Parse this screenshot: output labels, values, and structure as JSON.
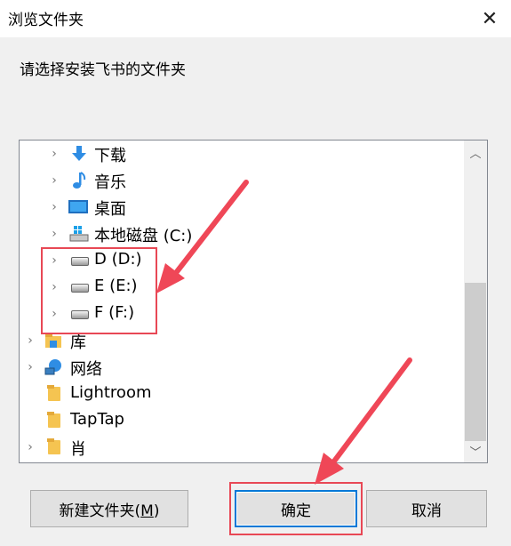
{
  "window": {
    "title": "浏览文件夹",
    "close_glyph": "✕"
  },
  "prompt": "请选择安装飞书的文件夹",
  "tree": {
    "items": [
      {
        "label": "下载",
        "icon": "download-icon"
      },
      {
        "label": "音乐",
        "icon": "music-icon"
      },
      {
        "label": "桌面",
        "icon": "desktop-icon"
      },
      {
        "label": "本地磁盘 (C:)",
        "icon": "windows-drive-icon"
      },
      {
        "label": "D (D:)",
        "icon": "drive-icon"
      },
      {
        "label": "E (E:)",
        "icon": "drive-icon"
      },
      {
        "label": "F (F:)",
        "icon": "drive-icon"
      },
      {
        "label": "库",
        "icon": "library-icon"
      },
      {
        "label": "网络",
        "icon": "network-icon"
      },
      {
        "label": "Lightroom",
        "icon": "folder-icon"
      },
      {
        "label": "TapTap",
        "icon": "folder-icon"
      },
      {
        "label": "肖",
        "icon": "folder-icon"
      }
    ]
  },
  "buttons": {
    "new_folder_pre": "新建文件夹(",
    "new_folder_key": "M",
    "new_folder_post": ")",
    "ok": "确定",
    "cancel": "取消"
  },
  "colors": {
    "highlight": "#e84855",
    "accent": "#0078d7"
  }
}
